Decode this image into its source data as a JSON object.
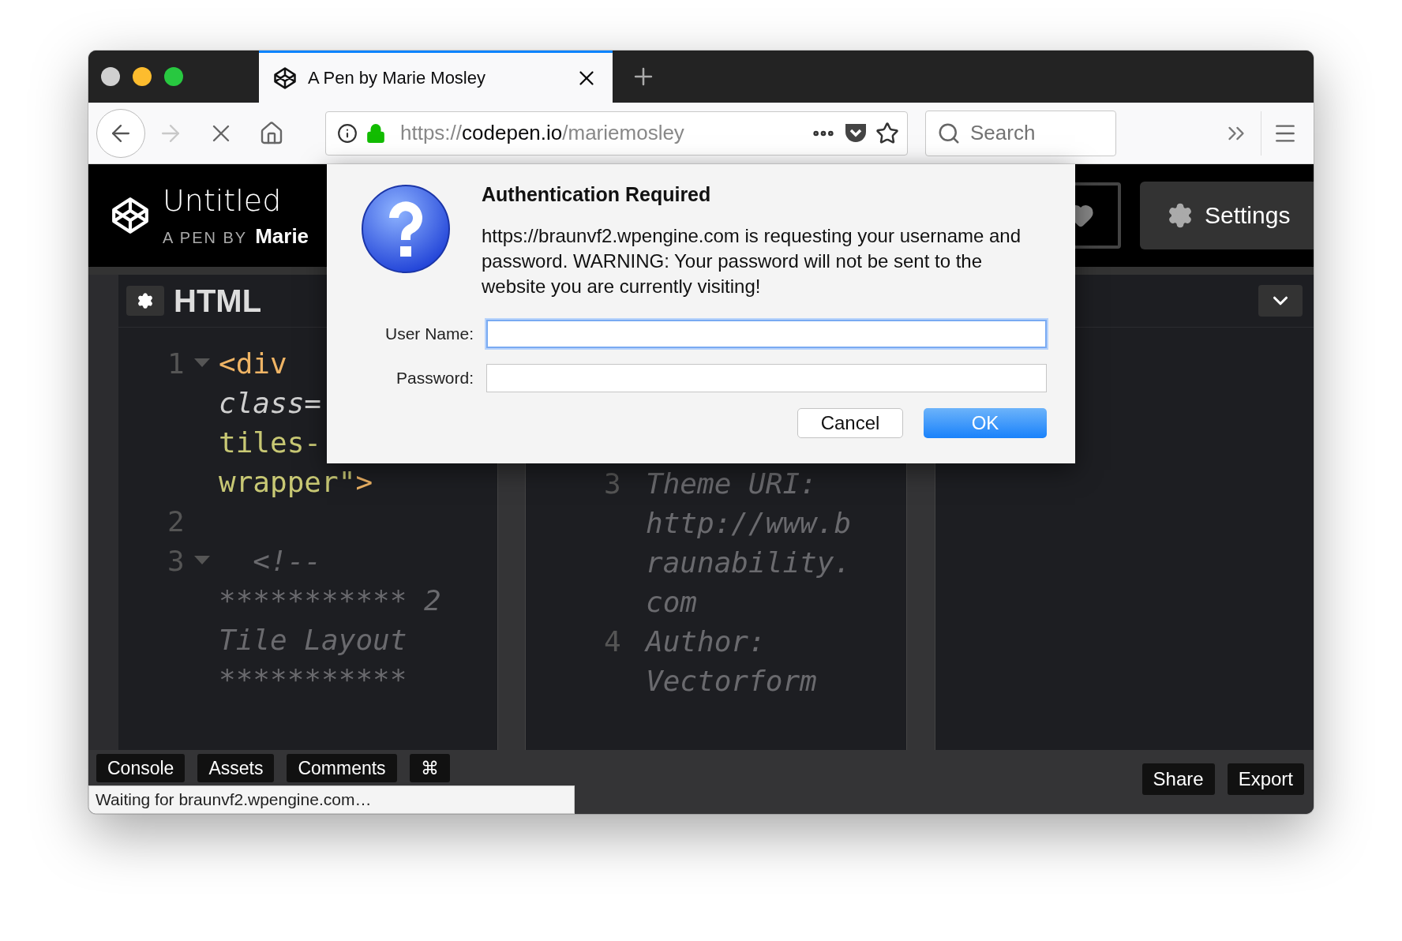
{
  "browser": {
    "tab": {
      "title": "A Pen by Marie Mosley",
      "selected": true
    },
    "address": {
      "scheme": "https://",
      "host": "codepen.io",
      "path": "/mariemosley"
    },
    "search": {
      "placeholder": "Search"
    }
  },
  "pen": {
    "title": "Untitled",
    "byline": "A PEN BY",
    "author": "Marie",
    "settings": "Settings"
  },
  "editors": [
    {
      "title": "HTML",
      "lines": [
        {
          "number": "1",
          "fold": true,
          "segments": [
            {
              "text": "<div",
              "kind": "tag"
            }
          ]
        },
        {
          "segments": [
            {
              "text": "class=",
              "kind": "attr"
            }
          ]
        },
        {
          "segments": [
            {
              "text": "tiles-",
              "kind": "string"
            }
          ]
        },
        {
          "segments": [
            {
              "text": "wrapper\"",
              "kind": "string"
            },
            {
              "text": ">",
              "kind": "tag"
            }
          ]
        },
        {
          "number": "2",
          "fold": false
        },
        {
          "number": "3",
          "fold": true,
          "segments": [
            {
              "text": "  <!--",
              "kind": "comment"
            }
          ]
        },
        {
          "segments": [
            {
              "text": "*********** 2",
              "kind": "comment"
            }
          ]
        },
        {
          "segments": [
            {
              "text": "Tile Layout",
              "kind": "comment"
            }
          ]
        },
        {
          "segments": [
            {
              "text": "***********",
              "kind": "comment"
            }
          ]
        }
      ]
    },
    {
      "lines": [
        {
          "number": "3",
          "fold": false,
          "segments": [
            {
              "text": "Theme URI:",
              "kind": "comment"
            }
          ]
        },
        {
          "segments": [
            {
              "text": "http://www.b",
              "kind": "comment"
            }
          ]
        },
        {
          "segments": [
            {
              "text": "raunability.",
              "kind": "comment"
            }
          ]
        },
        {
          "segments": [
            {
              "text": "com",
              "kind": "comment"
            }
          ]
        },
        {
          "number": "4",
          "fold": false,
          "segments": [
            {
              "text": "Author:",
              "kind": "comment"
            }
          ]
        },
        {
          "segments": [
            {
              "text": "Vectorform",
              "kind": "comment"
            }
          ]
        }
      ]
    }
  ],
  "footer": {
    "tools": [
      "Console",
      "Assets",
      "Comments",
      "⌘"
    ],
    "actions": [
      "Share",
      "Export"
    ]
  },
  "status": "Waiting for braunvf2.wpengine.com…",
  "dialog": {
    "title": "Authentication Required",
    "message": "https://braunvf2.wpengine.com is requesting your username and password. WARNING: Your password will not be sent to the website you are currently visiting!",
    "fields": [
      {
        "label": "User Name:",
        "focused": true
      },
      {
        "label": "Password:",
        "focused": false
      }
    ],
    "buttons": [
      {
        "label": "Cancel",
        "default": false
      },
      {
        "label": "OK",
        "default": true
      }
    ]
  }
}
